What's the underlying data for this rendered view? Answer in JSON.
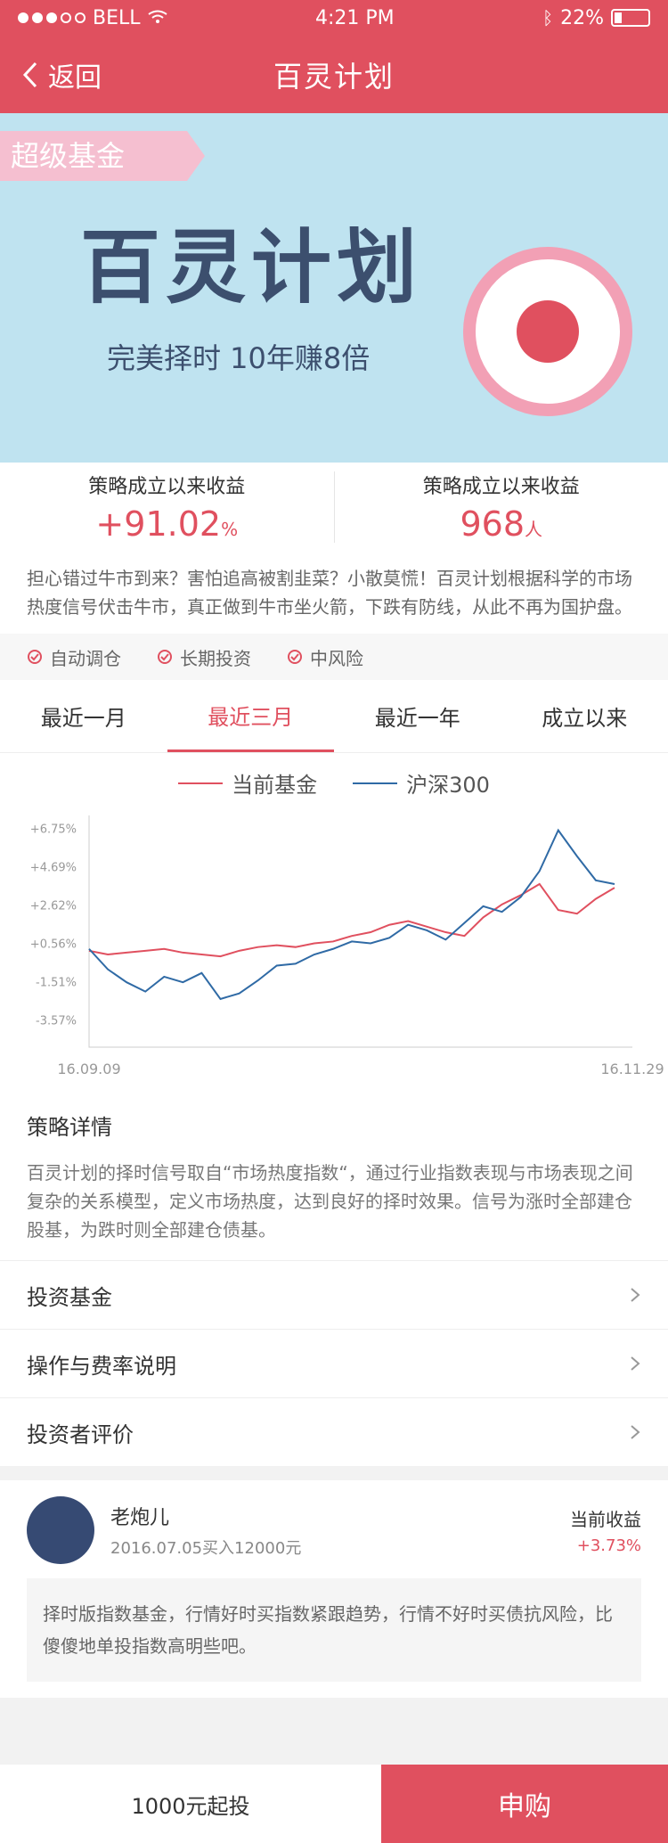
{
  "status": {
    "carrier": "BELL",
    "time": "4:21 PM",
    "battery": "22%"
  },
  "nav": {
    "back_label": "返回",
    "title": "百灵计划"
  },
  "banner": {
    "tag": "超级基金",
    "title": "百灵计划",
    "subtitle": "完美择时 10年赚8倍"
  },
  "stats": {
    "left": {
      "label": "策略成立以来收益",
      "value": "+91.02",
      "unit": "%"
    },
    "right": {
      "label": "策略成立以来收益",
      "value": "968",
      "unit": "人"
    }
  },
  "description": "担心错过牛市到来？害怕追高被割韭菜？小散莫慌！百灵计划根据科学的市场热度信号伏击牛市，真正做到牛市坐火箭，下跌有防线，从此不再为国护盘。",
  "features": [
    "自动调仓",
    "长期投资",
    "中风险"
  ],
  "tabs": [
    "最近一月",
    "最近三月",
    "最近一年",
    "成立以来"
  ],
  "chart_data": {
    "type": "line",
    "title": "",
    "x": [
      "16.09.09",
      "16.11.29"
    ],
    "ylabels": [
      "+6.75%",
      "+4.69%",
      "+2.62%",
      "+0.56%",
      "-1.51%",
      "-3.57%"
    ],
    "series": [
      {
        "name": "当前基金",
        "color": "#e0505f",
        "values": [
          0.2,
          0.0,
          0.1,
          0.2,
          0.3,
          0.1,
          0.0,
          -0.1,
          0.2,
          0.4,
          0.5,
          0.4,
          0.6,
          0.7,
          1.0,
          1.2,
          1.6,
          1.8,
          1.5,
          1.2,
          1.0,
          2.0,
          2.7,
          3.2,
          3.8,
          2.4,
          2.2,
          3.0,
          3.6
        ]
      },
      {
        "name": "沪深300",
        "color": "#2f6aa5",
        "values": [
          0.3,
          -0.8,
          -1.5,
          -2.0,
          -1.2,
          -1.5,
          -1.0,
          -2.4,
          -2.1,
          -1.4,
          -0.6,
          -0.5,
          0.0,
          0.3,
          0.7,
          0.6,
          0.9,
          1.6,
          1.3,
          0.8,
          1.7,
          2.6,
          2.3,
          3.1,
          4.5,
          6.7,
          5.3,
          4.0,
          3.8
        ]
      }
    ],
    "ylim": [
      -5,
      7.5
    ],
    "grid": false
  },
  "strategy": {
    "title": "策略详情",
    "body": "百灵计划的择时信号取自“市场热度指数“，通过行业指数表现与市场表现之间复杂的关系模型，定义市场热度，达到良好的择时效果。信号为涨时全部建仓股基，为跌时则全部建仓债基。"
  },
  "links": [
    "投资基金",
    "操作与费率说明",
    "投资者评价"
  ],
  "review": {
    "name": "老炮儿",
    "date": "2016.07.05买入12000元",
    "earn_label": "当前收益",
    "earn_value": "+3.73%",
    "comment": "择时版指数基金，行情好时买指数紧跟趋势，行情不好时买债抗风险，比傻傻地单投指数高明些吧。"
  },
  "footer": {
    "min_invest": "1000元起投",
    "buy": "申购"
  }
}
